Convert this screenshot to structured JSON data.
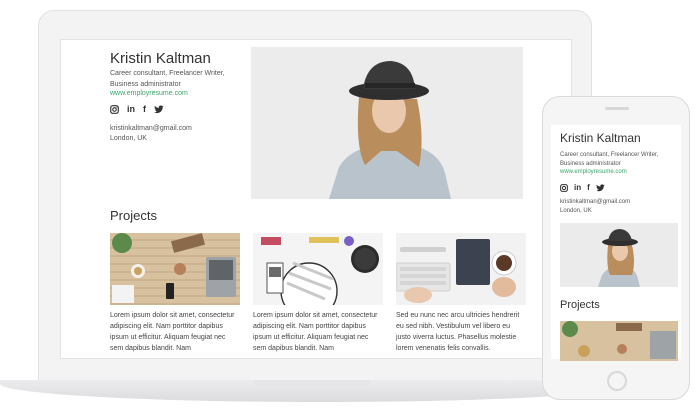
{
  "profile": {
    "name": "Kristin Kaltman",
    "role_line1": "Career consultant, Freelancer Writer,",
    "role_line2": "Business administrator",
    "website": "www.employresume.com",
    "email": "kristinkaltman@gmail.com",
    "location": "London, UK"
  },
  "social": [
    {
      "icon": "instagram-icon"
    },
    {
      "icon": "linkedin-icon",
      "label": "in"
    },
    {
      "icon": "facebook-icon",
      "label": "f"
    },
    {
      "icon": "twitter-icon"
    }
  ],
  "projects": {
    "heading": "Projects",
    "items": [
      {
        "desc": "Lorem ipsum dolor sit amet, consectetur adipiscing elit. Nam porttitor dapibus ipsum ut efficitur. Aliquam feugiat nec sem dapibus blandit. Nam"
      },
      {
        "desc": "Lorem ipsum dolor sit amet, consectetur adipiscing elit. Nam porttitor dapibus ipsum ut efficitur. Aliquam feugiat nec sem dapibus blandit. Nam"
      },
      {
        "desc": "Sed eu nunc nec arcu ultricies hendrerit eu sed nibh. Vestibulum vel libero eu justo viverra luctus. Phasellus molestie lorem venenatis felis convallis."
      }
    ]
  },
  "phone_profile": {
    "name": "Kristin Kaltman",
    "role": "Career consultant, Freelancer Writer, Business administrator",
    "website": "www.employresume.com",
    "email": "kristinkaltman@gmail.com",
    "location": "London, UK",
    "projects_heading": "Projects"
  },
  "colors": {
    "link": "#3aa56a",
    "text": "#333333",
    "device": "#f3f3f4"
  }
}
